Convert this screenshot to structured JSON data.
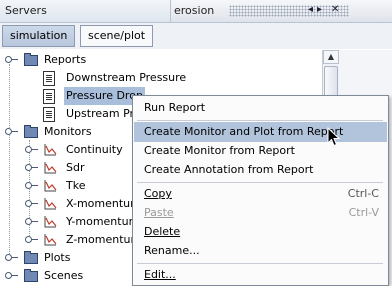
{
  "panel": {
    "title": "Servers",
    "window_label": "erosion",
    "controls": [
      "◂",
      "▸",
      "✕"
    ]
  },
  "tabs": [
    {
      "label": "simulation",
      "active": true
    },
    {
      "label": "scene/plot",
      "active": false
    }
  ],
  "tree": {
    "reports_label": "Reports",
    "report_items": [
      "Downstream Pressure",
      "Pressure Drop",
      "Upstream Pr"
    ],
    "monitors_label": "Monitors",
    "monitor_items": [
      "Continuity",
      "Sdr",
      "Tke",
      "X-momentum",
      "Y-momentum",
      "Z-momentum"
    ],
    "plots_label": "Plots",
    "scenes_label": "Scenes"
  },
  "context_menu": {
    "run_report": "Run Report",
    "create_monitor_and_plot": "Create Monitor and Plot from Report",
    "create_monitor": "Create Monitor from Report",
    "create_annotation": "Create Annotation from Report",
    "copy": "Copy",
    "copy_shortcut": "Ctrl-C",
    "paste": "Paste",
    "paste_shortcut": "Ctrl-V",
    "delete": "Delete",
    "rename": "Rename...",
    "edit": "Edit..."
  },
  "colors": {
    "selection": "#a9bedb",
    "menu_highlight": "#b1c4dc",
    "folder": "#6f88b4"
  }
}
